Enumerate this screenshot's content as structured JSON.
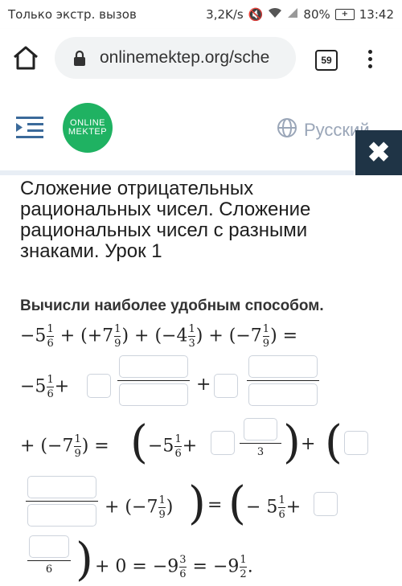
{
  "status_bar": {
    "carrier": "Только экстр. вызов",
    "speed": "3,2K/s",
    "battery": "80%",
    "time": "13:42"
  },
  "browser": {
    "url": "onlinemektep.org/sche",
    "tab_count": "59"
  },
  "site": {
    "logo_line1": "ONLINE",
    "logo_line2": "MEKTEP",
    "language": "Русский",
    "close": "✖"
  },
  "lesson": {
    "title": "Сложение отрицательных рациональных чисел. Сложение рациональных чисел с разными знаками. Урок 1",
    "task": "Вычисли наиболее удобным способом."
  },
  "math": {
    "line1": {
      "t1": "−5",
      "f1n": "1",
      "f1d": "6",
      "t2": " + (+7",
      "f2n": "1",
      "f2d": "9",
      "t3": ") + (−4",
      "f3n": "1",
      "f3d": "3",
      "t4": ") + (−7",
      "f4n": "1",
      "f4d": "9",
      "t5": ") ="
    },
    "line2": {
      "t1": "−5",
      "fn": "1",
      "fd": "6",
      "plus1": "+",
      "plus2": "+"
    },
    "line3": {
      "t1": "+ (−7",
      "fn": "1",
      "fd": "9",
      "t2": ") =",
      "t3": "−5",
      "f2n": "1",
      "f2d": "6",
      "plus": "+",
      "den": "3",
      "plus2": "+"
    },
    "line4": {
      "t1": "+ (−7",
      "fn": "1",
      "fd": "9",
      "t2": ")",
      "eq": "=",
      "t3": "− 5",
      "f2n": "1",
      "f2d": "6",
      "plus": "+"
    },
    "line5": {
      "den": "6",
      "t1": "+ 0 = −9",
      "fn": "3",
      "fd": "6",
      "t2": " = −9",
      "f2n": "1",
      "f2d": "2",
      "t3": "."
    }
  }
}
